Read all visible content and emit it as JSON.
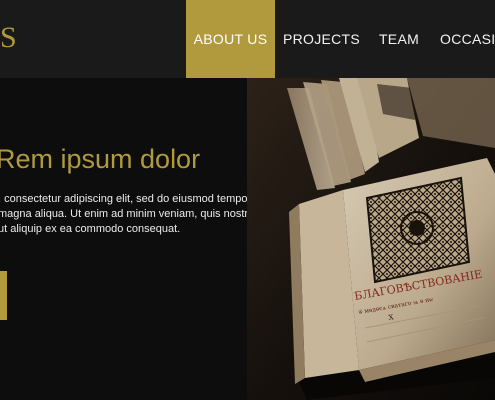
{
  "logo": {
    "text": "S"
  },
  "nav": {
    "items": [
      {
        "label": "ABOUT US",
        "active": true
      },
      {
        "label": "PROJECTS",
        "active": false
      },
      {
        "label": "TEAM",
        "active": false
      },
      {
        "label": "OCCASIO",
        "active": false
      }
    ]
  },
  "hero": {
    "title": "Rem ipsum dolor",
    "lines": [
      ", consectetur adipiscing elit, sed do eiusmod tempor incidi-",
      "magna aliqua. Ut enim ad minim veniam, quis nostrud exerci-",
      " ut aliquip ex ea commodo consequat."
    ],
    "image": {
      "name": "old-book-photo",
      "book_heading": "БЛАГОВѢСТВОВАНІЕ",
      "book_line": "ѿ мѳдѳєѧ сватаго ѩ ѳ нѡ",
      "page_mark": "Х"
    }
  },
  "colors": {
    "accent": "#b19a3e",
    "nav_bg": "#1a1a1a",
    "page_bg": "#0d0d0d",
    "text": "#ececec"
  }
}
